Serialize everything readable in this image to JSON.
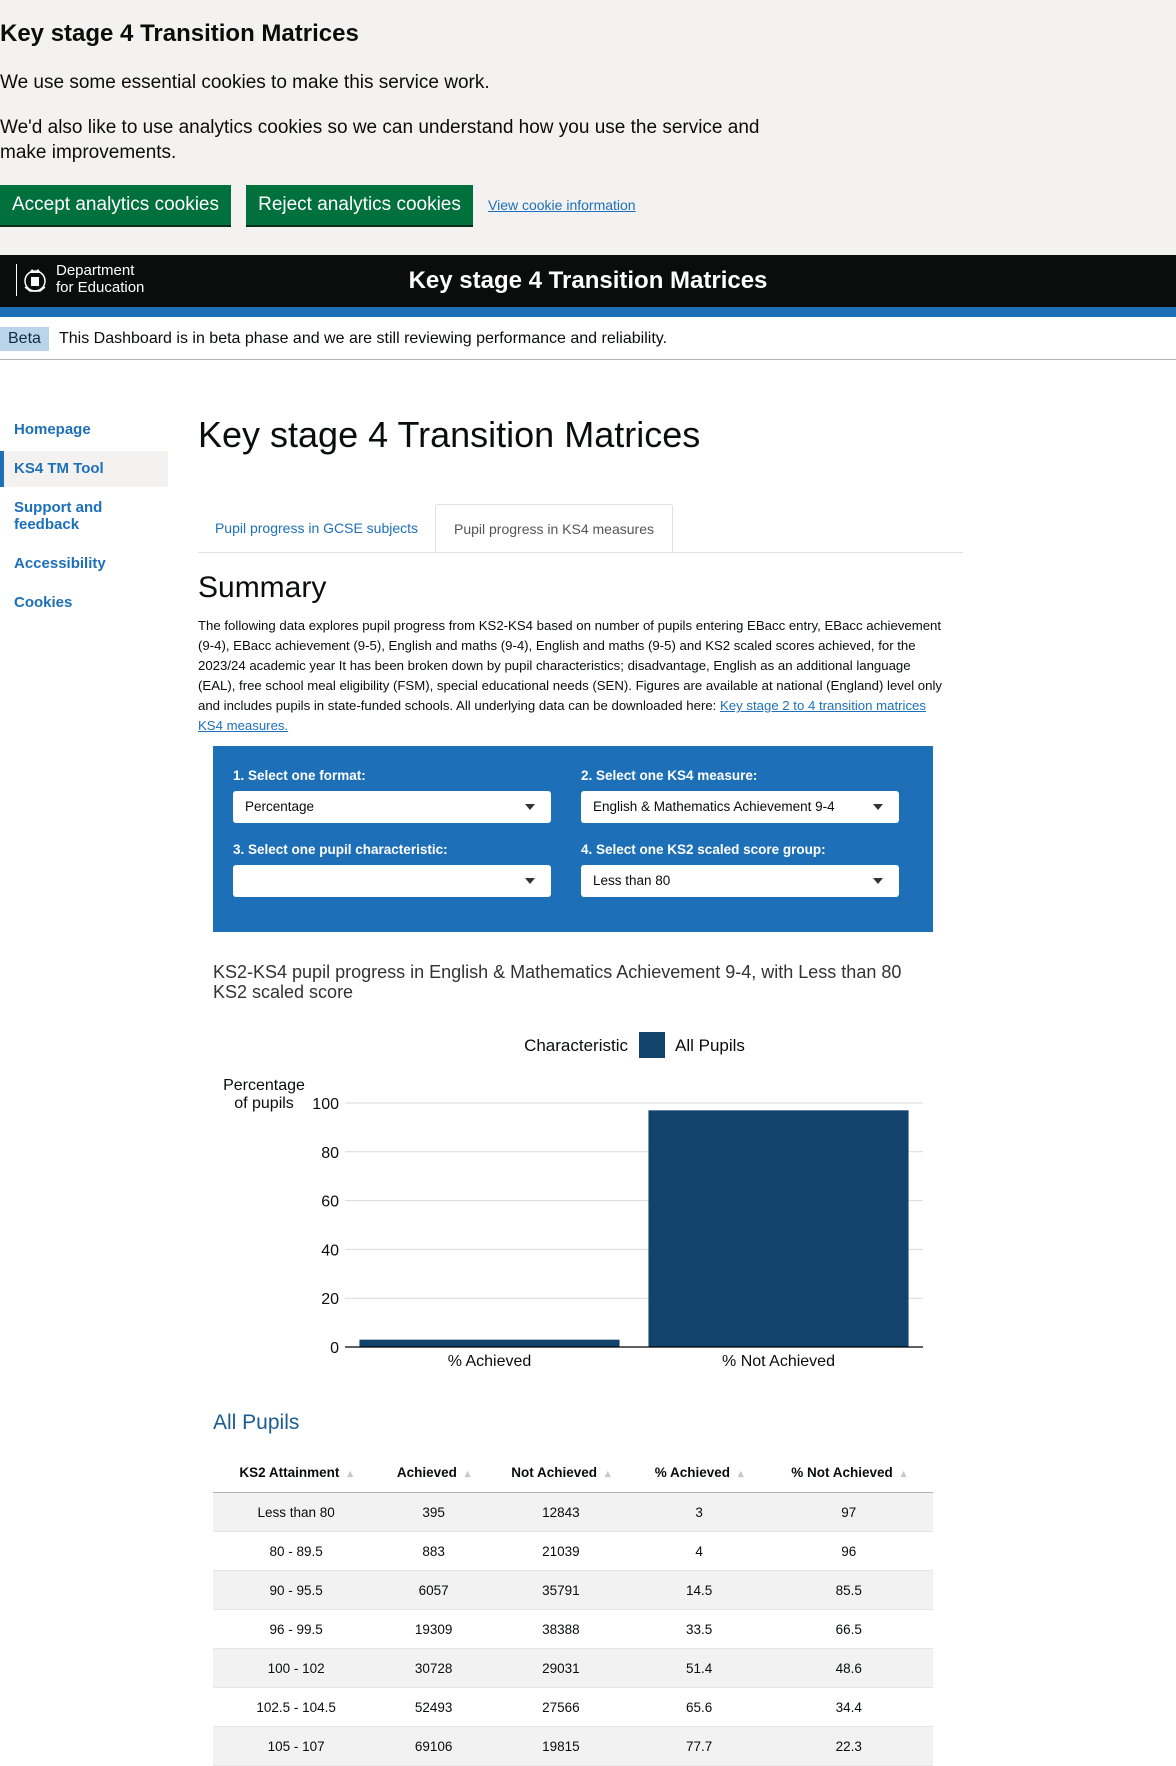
{
  "cookie_banner": {
    "title": "Key stage 4 Transition Matrices",
    "p1": "We use some essential cookies to make this service work.",
    "p2": "We'd also like to use analytics cookies so we can understand how you use the service and make improvements.",
    "accept": "Accept analytics cookies",
    "reject": "Reject analytics cookies",
    "info_link": "View cookie information"
  },
  "header": {
    "org_line1": "Department",
    "org_line2": "for Education",
    "title": "Key stage 4 Transition Matrices"
  },
  "beta": {
    "tag": "Beta",
    "text": "This Dashboard is in beta phase and we are still reviewing performance and reliability."
  },
  "nav": {
    "items": [
      {
        "label": "Homepage"
      },
      {
        "label": "KS4 TM Tool"
      },
      {
        "label": "Support and feedback"
      },
      {
        "label": "Accessibility"
      },
      {
        "label": "Cookies"
      }
    ]
  },
  "main": {
    "title": "Key stage 4 Transition Matrices",
    "tabs": [
      {
        "label": "Pupil progress in GCSE subjects"
      },
      {
        "label": "Pupil progress in KS4 measures"
      }
    ],
    "summary_heading": "Summary",
    "summary_text": "The following data explores pupil progress from KS2-KS4 based on number of pupils entering EBacc entry, EBacc achievement (9-4), EBacc achievement (9-5), English and maths (9-4), English and maths (9-5) and KS2 scaled scores achieved, for the 2023/24 academic year It has been broken down by pupil characteristics; disadvantage, English as an additional language (EAL), free school meal eligibility (FSM), special educational needs (SEN). Figures are available at national (England) level only and includes pupils in state-funded schools. All underlying data can be downloaded here: ",
    "summary_link": "Key stage 2 to 4 transition matrices KS4 measures."
  },
  "filters": {
    "format_label": "1. Select one format:",
    "format_value": "Percentage",
    "measure_label": "2. Select one KS4 measure:",
    "measure_value": "English & Mathematics Achievement 9-4",
    "characteristic_label": "3. Select one pupil characteristic:",
    "characteristic_value": "",
    "ks2_label": "4. Select one KS2 scaled score group:",
    "ks2_value": "Less than 80"
  },
  "chart_data": {
    "type": "bar",
    "title": "KS2-KS4 pupil progress in English & Mathematics Achievement 9-4, with Less than 80 KS2 scaled score",
    "ylabel": "Percentage of pupils",
    "xlabel": "",
    "categories": [
      "% Achieved",
      "% Not Achieved"
    ],
    "series": [
      {
        "name": "All Pupils",
        "values": [
          3,
          97
        ]
      }
    ],
    "legend_title": "Characteristic",
    "legend_position": "top",
    "ylim": [
      0,
      100
    ],
    "yticks": [
      0,
      20,
      40,
      60,
      80,
      100
    ],
    "grid": true,
    "color": "#12436d"
  },
  "table": {
    "title": "All Pupils",
    "columns": [
      "KS2 Attainment",
      "Achieved",
      "Not Achieved",
      "% Achieved",
      "% Not Achieved"
    ],
    "rows": [
      [
        "Less than 80",
        "395",
        "12843",
        "3",
        "97"
      ],
      [
        "80 - 89.5",
        "883",
        "21039",
        "4",
        "96"
      ],
      [
        "90 - 95.5",
        "6057",
        "35791",
        "14.5",
        "85.5"
      ],
      [
        "96 - 99.5",
        "19309",
        "38388",
        "33.5",
        "66.5"
      ],
      [
        "100 - 102",
        "30728",
        "29031",
        "51.4",
        "48.6"
      ],
      [
        "102.5 - 104.5",
        "52493",
        "27566",
        "65.6",
        "34.4"
      ],
      [
        "105 - 107",
        "69106",
        "19815",
        "77.7",
        "22.3"
      ]
    ]
  }
}
